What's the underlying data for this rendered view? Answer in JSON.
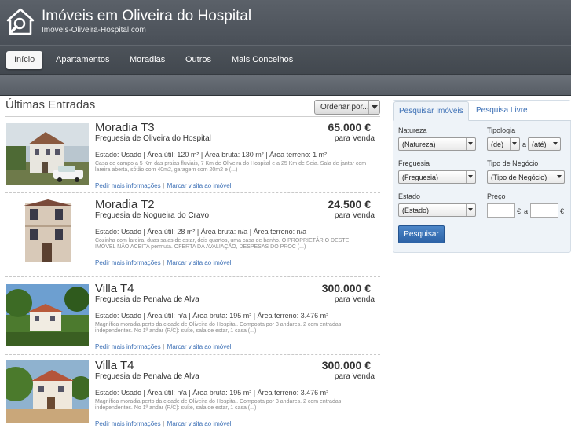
{
  "header": {
    "title": "Imóveis em Oliveira do Hospital",
    "url_text": "Imoveis-Oliveira-Hospital.com",
    "logo_icon": "house-search-icon"
  },
  "nav": {
    "items": [
      {
        "label": "Início",
        "active": true
      },
      {
        "label": "Apartamentos"
      },
      {
        "label": "Moradias"
      },
      {
        "label": "Outros"
      },
      {
        "label": "Mais Concelhos"
      }
    ]
  },
  "listings": {
    "title": "Últimas Entradas",
    "sort_label": "Ordenar por...",
    "items": [
      {
        "title": "Moradia  T3",
        "parish": "Freguesia de Oliveira do Hospital",
        "price": "65.000 €",
        "deal": "para Venda",
        "stats": "Estado: Usado  | Área útil: 120 m²  | Área bruta: 130 m²  | Área terreno: 1 m²",
        "description": "Casa de campo a 5 Km das praias fluviais, 7 Km de Oliveira do Hospital e a 25 Km de Seia. Sala de jantar com lareira aberta, sótão com 40m2, garagem com 20m2 e (...)",
        "link_more": "Pedir mais informações",
        "link_visit": "Marcar visita ao imóvel"
      },
      {
        "title": "Moradia  T2",
        "parish": "Freguesia de Nogueira do Cravo",
        "price": "24.500 €",
        "deal": "para Venda",
        "stats": "Estado: Usado  | Área útil: 28 m²  | Área bruta: n/a  | Área terreno: n/a",
        "description": "Cozinha com lareira, duas salas de estar, dois quartos, uma casa de banho. O PROPRIETÁRIO DESTE IMÓVEL NÃO ACEITA permuta. OFERTA DA AVALIAÇÃO, DESPESAS DO PROC (...)",
        "link_more": "Pedir mais informações",
        "link_visit": "Marcar visita ao imóvel"
      },
      {
        "title": "Villa  T4",
        "parish": "Freguesia de Penalva de Alva",
        "price": "300.000 €",
        "deal": "para Venda",
        "stats": "Estado: Usado  | Área útil: n/a  | Área bruta: 195 m²  | Área terreno: 3.476 m²",
        "description": "Magnífica moradia perto da cidade de Oliveira do Hospital. Composta por 3 andares. 2 com entradas independentes. No 1º andar (R/C): suíte, sala de estar, 1 casa (...)",
        "link_more": "Pedir mais informações",
        "link_visit": "Marcar visita ao imóvel"
      },
      {
        "title": "Villa  T4",
        "parish": "Freguesia de Penalva de Alva",
        "price": "300.000 €",
        "deal": "para Venda",
        "stats": "Estado: Usado  | Área útil: n/a  | Área bruta: 195 m²  | Área terreno: 3.476 m²",
        "description": "Magnífica moradia perto da cidade de Oliveira do Hospital. Composta por 3 andares. 2 com entradas independentes. No 1º andar (R/C): suíte, sala de estar, 1 casa (...)",
        "link_more": "Pedir mais informações",
        "link_visit": "Marcar visita ao imóvel"
      }
    ]
  },
  "search": {
    "tab_imoveis": "Pesquisar Imóveis",
    "tab_livre": "Pesquisa Livre",
    "natureza_label": "Natureza",
    "natureza_value": "(Natureza)",
    "tipologia_label": "Tipologia",
    "tipologia_from": "(de)",
    "tipologia_sep": "a",
    "tipologia_to": "(até)",
    "freguesia_label": "Freguesia",
    "freguesia_value": "(Freguesia)",
    "negocio_label": "Tipo de Negócio",
    "negocio_value": "(Tipo de Negócio)",
    "estado_label": "Estado",
    "estado_value": "(Estado)",
    "preco_label": "Preço",
    "currency": "€",
    "preco_sep": "a",
    "button": "Pesquisar"
  },
  "colors": {
    "header": "#4a5058",
    "link": "#3b6fb5",
    "button": "#2c62a6",
    "panel": "#eef3f8"
  }
}
